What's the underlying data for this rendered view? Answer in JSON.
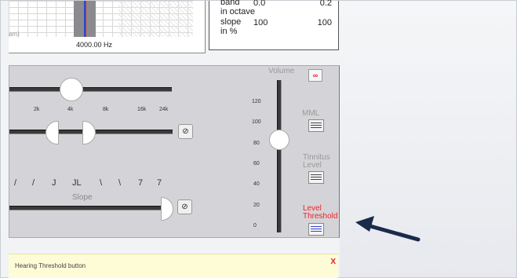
{
  "top_panel": {
    "freq_label": "4000.00 Hz",
    "left_clip": "am)"
  },
  "info_box": {
    "row0": "band",
    "row1": "in octave",
    "row2": "slope",
    "row3": "in %",
    "v1_top": "0.0",
    "v2_top": "0.2",
    "v1_slope": "100",
    "v2_slope": "100"
  },
  "freq_ticks": [
    "2k",
    "4k",
    "8k",
    "16k",
    "24k"
  ],
  "slope": {
    "label": "Slope",
    "glyphs": [
      "/",
      "/",
      "J",
      "JL",
      "\\",
      "\\",
      "7",
      "7"
    ]
  },
  "volume": {
    "label": "Volume",
    "scale": [
      "120",
      "100",
      "80",
      "60",
      "40",
      "20",
      "0"
    ]
  },
  "side_controls": {
    "mml": "MML",
    "tinnitus_1": "Tinnitus",
    "tinnitus_2": "Level",
    "level_1": "Level",
    "level_2": "Threshold"
  },
  "footer": {
    "text": "Hearing Threshold button",
    "close": "X"
  },
  "colors": {
    "accent_red": "#ee2222",
    "arrow": "#1a2a4a",
    "panel": "#d4d4d8",
    "footer_bg": "#fdfcd7"
  }
}
